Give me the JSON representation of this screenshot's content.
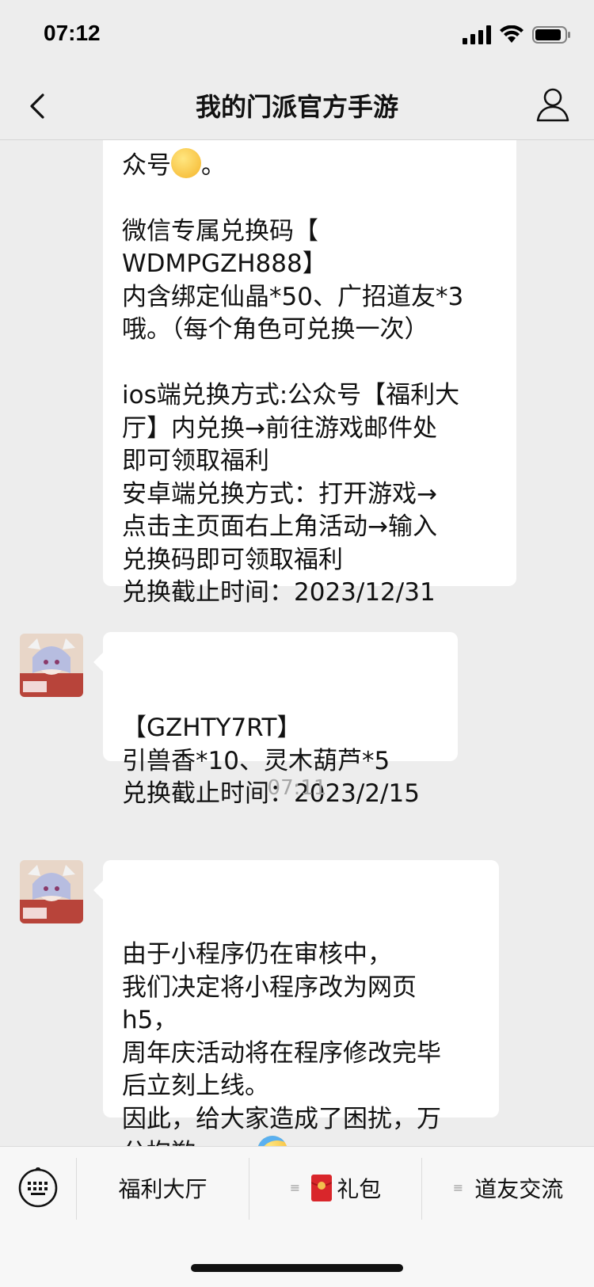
{
  "status_bar": {
    "time": "07:12"
  },
  "nav": {
    "title": "我的门派官方手游"
  },
  "messages": {
    "m1": {
      "partial_line": "众号",
      "partial_tail": "。",
      "text": "微信专属兑换码【\nWDMPGZH888】\n内含绑定仙晶*50、广招道友*3\n哦。（每个角色可兑换一次）\n\nios端兑换方式:公众号【福利大\n厅】内兑换→前往游戏邮件处\n即可领取福利\n安卓端兑换方式：打开游戏→\n点击主页面右上角活动→输入\n兑换码即可领取福利\n兑换截止时间：2023/12/31"
    },
    "m2": {
      "text": "【GZHTY7RT】\n引兽香*10、灵木葫芦*5\n兑换截止时间：2023/2/15"
    },
    "timestamp": "07:11",
    "m3": {
      "text": "由于小程序仍在审核中，\n我们决定将小程序改为网页\nh5，\n周年庆活动将在程序修改完毕\n后立刻上线。\n因此，给大家造成了困扰，万\n分抱歉~~~"
    }
  },
  "menu": {
    "item1": "福利大厅",
    "item2": "礼包",
    "item3": "道友交流"
  }
}
